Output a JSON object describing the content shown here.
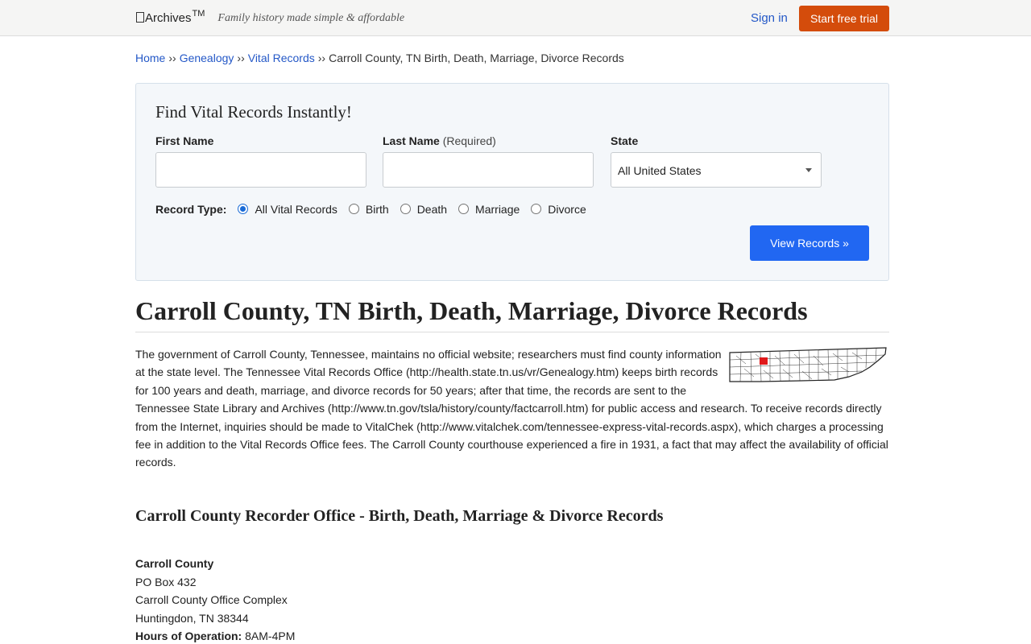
{
  "header": {
    "logo_text": "Archives",
    "logo_tm": "TM",
    "tagline": "Family history made simple & affordable",
    "signin_label": "Sign in",
    "trial_label": "Start free trial",
    "trial_color": "#d44c0b"
  },
  "breadcrumb": {
    "items": [
      "Home",
      "Genealogy",
      "Vital Records"
    ],
    "separator": "››",
    "current": "Carroll County, TN Birth, Death, Marriage, Divorce Records"
  },
  "search": {
    "title": "Find Vital Records Instantly!",
    "first_name_label": "First Name",
    "last_name_label": "Last Name",
    "last_name_required": "(Required)",
    "first_name_value": "",
    "last_name_value": "",
    "state_label": "State",
    "state_selected": "All United States",
    "record_type_label": "Record Type:",
    "record_types": [
      "All Vital Records",
      "Birth",
      "Death",
      "Marriage",
      "Divorce"
    ],
    "record_type_selected": "All Vital Records",
    "submit_label": "View Records »",
    "submit_color": "#2167f2"
  },
  "main": {
    "title": "Carroll County, TN Birth, Death, Marriage, Divorce Records",
    "intro": "The government of Carroll County, Tennessee, maintains no official website; researchers must find county information at the state level. The Tennessee Vital Records Office (http://health.state.tn.us/vr/Genealogy.htm) keeps birth records for 100 years and death, marriage, and divorce records for 50 years; after that time, the records are sent to the Tennessee State Library and Archives (http://www.tn.gov/tsla/history/county/factcarroll.htm) for public access and research. To receive records directly from the Internet, inquiries should be made to VitalChek (http://www.vitalchek.com/tennessee-express-vital-records.aspx), which charges a processing fee in addition to the Vital Records Office fees. The Carroll County courthouse experienced a fire in 1931, a fact that may affect the availability of official records.",
    "map_icon": "tennessee-county-map",
    "map_highlight_color": "#e0191b",
    "office_title": "Carroll County Recorder Office - Birth, Death, Marriage & Divorce Records"
  },
  "office": {
    "name": "Carroll County",
    "line1": "PO Box 432",
    "line2": "Carroll County Office Complex",
    "line3": "Huntingdon, TN 38344",
    "hours_label": "Hours of Operation:",
    "hours_value": "8AM-4PM"
  }
}
